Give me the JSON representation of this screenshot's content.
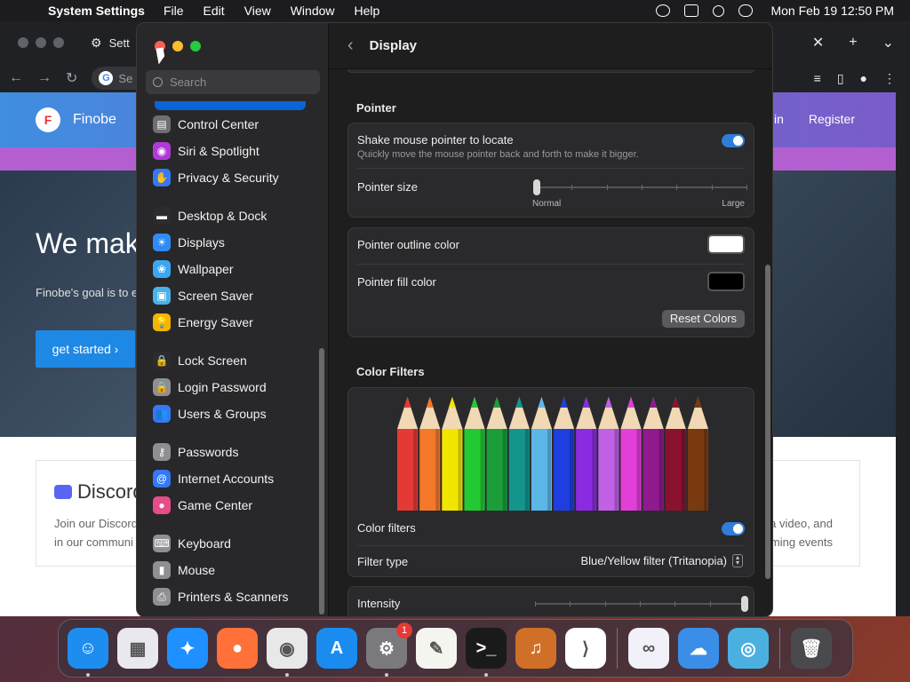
{
  "menubar": {
    "app_name": "System Settings",
    "menus": [
      "File",
      "Edit",
      "View",
      "Window",
      "Help"
    ],
    "clock": "Mon Feb 19  12:50 PM"
  },
  "browser": {
    "tab_title": "Sett",
    "omnibox_text": "Se",
    "website": {
      "brand": "Finobe",
      "nav": [
        "Login",
        "Register"
      ],
      "hero_title": "We mak",
      "hero_text": "Finobe's goal is to e",
      "cta": "get started ›",
      "card_title": "Discord",
      "card_text_lines": [
        "Join our Discord",
        "in our communi"
      ],
      "card_text_right_lines": [
        "a video, and",
        "ming events"
      ]
    }
  },
  "settings": {
    "search_placeholder": "Search",
    "sidebar": {
      "items": [
        {
          "label": "Control Center",
          "icon": "control-center-icon",
          "color": "#6e6e73"
        },
        {
          "label": "Siri & Spotlight",
          "icon": "siri-icon",
          "color": "#b03ad8"
        },
        {
          "label": "Privacy & Security",
          "icon": "hand-icon",
          "color": "#3478f6"
        },
        {
          "label": "Desktop & Dock",
          "icon": "dock-icon",
          "color": "#2c2c2e"
        },
        {
          "label": "Displays",
          "icon": "sun-icon",
          "color": "#2f8cf6"
        },
        {
          "label": "Wallpaper",
          "icon": "flower-icon",
          "color": "#3aa8f0"
        },
        {
          "label": "Screen Saver",
          "icon": "screen-saver-icon",
          "color": "#49b3e8"
        },
        {
          "label": "Energy Saver",
          "icon": "bulb-icon",
          "color": "#f5b400"
        },
        {
          "label": "Lock Screen",
          "icon": "lock-icon",
          "color": "#2c2c2e"
        },
        {
          "label": "Login Password",
          "icon": "lock-icon",
          "color": "#8e8e93"
        },
        {
          "label": "Users & Groups",
          "icon": "users-icon",
          "color": "#3478f6"
        },
        {
          "label": "Passwords",
          "icon": "key-icon",
          "color": "#8e8e93"
        },
        {
          "label": "Internet Accounts",
          "icon": "at-icon",
          "color": "#3478f6"
        },
        {
          "label": "Game Center",
          "icon": "game-center-icon",
          "color": "#e84c88"
        },
        {
          "label": "Keyboard",
          "icon": "keyboard-icon",
          "color": "#8e8e93"
        },
        {
          "label": "Mouse",
          "icon": "mouse-icon",
          "color": "#8e8e93"
        },
        {
          "label": "Printers & Scanners",
          "icon": "printer-icon",
          "color": "#8e8e93"
        }
      ]
    },
    "main": {
      "title": "Display",
      "pointer_heading": "Pointer",
      "shake_label": "Shake mouse pointer to locate",
      "shake_sub": "Quickly move the mouse pointer back and forth to make it bigger.",
      "shake_on": true,
      "pointer_size_label": "Pointer size",
      "pointer_size_min": "Normal",
      "pointer_size_max": "Large",
      "pointer_size_value": 0,
      "outline_label": "Pointer outline color",
      "outline_color": "#ffffff",
      "fill_label": "Pointer fill color",
      "fill_color": "#000000",
      "reset_label": "Reset Colors",
      "filters_heading": "Color Filters",
      "color_filters_label": "Color filters",
      "color_filters_on": true,
      "filter_type_label": "Filter type",
      "filter_type_value": "Blue/Yellow filter (Tritanopia)",
      "intensity_label": "Intensity",
      "intensity_value": 1.0,
      "pencil_colors": [
        "#e53935",
        "#f4782a",
        "#f2e600",
        "#22c933",
        "#1b9e3a",
        "#13958c",
        "#5bb7e8",
        "#1f3ee0",
        "#8a2be2",
        "#c061e6",
        "#e23ed8",
        "#8e1a8e",
        "#8a1230",
        "#7a3a10"
      ]
    }
  },
  "dock": {
    "apps": [
      {
        "name": "finder-icon",
        "color": "#1d8ef0",
        "glyph": "☺",
        "running": true
      },
      {
        "name": "launchpad-icon",
        "color": "#e8e8ee",
        "glyph": "▦",
        "running": false
      },
      {
        "name": "safari-icon",
        "color": "#1e90ff",
        "glyph": "✦",
        "running": false
      },
      {
        "name": "firefox-icon",
        "color": "#ff7139",
        "glyph": "●",
        "running": false
      },
      {
        "name": "chrome-icon",
        "color": "#e8e8e8",
        "glyph": "◉",
        "running": true
      },
      {
        "name": "app-store-icon",
        "color": "#1a8cf0",
        "glyph": "A",
        "running": false
      },
      {
        "name": "system-settings-icon",
        "color": "#7a7a7e",
        "glyph": "⚙",
        "running": true,
        "badge": "1"
      },
      {
        "name": "textedit-icon",
        "color": "#f5f5f0",
        "glyph": "✎",
        "running": false
      },
      {
        "name": "terminal-icon",
        "color": "#1a1a1a",
        "glyph": ">_",
        "running": true
      },
      {
        "name": "garageband-icon",
        "color": "#d07028",
        "glyph": "♫",
        "running": false
      },
      {
        "name": "vscode-icon",
        "color": "#ffffff",
        "glyph": "⟩",
        "running": false
      },
      {
        "name": "visual-studio-icon",
        "color": "#f2f0f8",
        "glyph": "∞",
        "running": false
      },
      {
        "name": "weather-icon",
        "color": "#3a8ee8",
        "glyph": "☁",
        "running": false
      },
      {
        "name": "screen-capture-icon",
        "color": "#4ab0e0",
        "glyph": "◎",
        "running": false
      },
      {
        "name": "trash-icon",
        "color": "#4a4a4e",
        "glyph": "🗑",
        "running": false
      }
    ]
  }
}
